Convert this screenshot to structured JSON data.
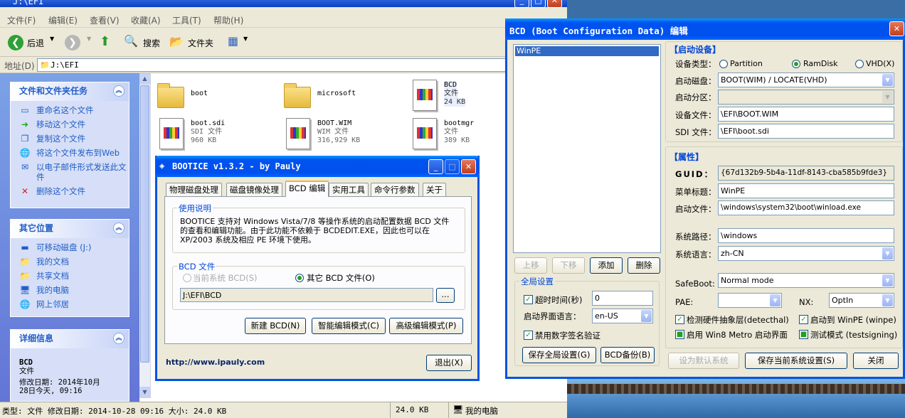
{
  "explorer": {
    "title": "J:\\EFI",
    "menu": [
      "文件(F)",
      "编辑(E)",
      "查看(V)",
      "收藏(A)",
      "工具(T)",
      "帮助(H)"
    ],
    "toolbar": {
      "back": "后退",
      "search": "搜索",
      "folders": "文件夹"
    },
    "address_label": "地址(D)",
    "address_value": "J:\\EFI",
    "tasks": {
      "title": "文件和文件夹任务",
      "items": [
        "重命名这个文件",
        "移动这个文件",
        "复制这个文件",
        "将这个文件发布到Web",
        "以电子邮件形式发送此文件",
        "删除这个文件"
      ]
    },
    "places": {
      "title": "其它位置",
      "items": [
        "可移动磁盘 (J:)",
        "我的文档",
        "共享文档",
        "我的电脑",
        "网上邻居"
      ]
    },
    "details": {
      "title": "详细信息",
      "name": "BCD",
      "type": "文件",
      "modified": "修改日期: 2014年10月28日今天, 09:16"
    },
    "files": [
      {
        "name": "boot",
        "kind": "folder"
      },
      {
        "name": "microsoft",
        "kind": "folder"
      },
      {
        "name": "BCD",
        "type": "文件",
        "size": "24 KB",
        "kind": "file"
      },
      {
        "name": "boot.sdi",
        "type": "SDI 文件",
        "size": "960 KB",
        "kind": "file"
      },
      {
        "name": "BOOT.WIM",
        "type": "WIM 文件",
        "size": "316,929 KB",
        "kind": "file"
      },
      {
        "name": "bootmgr",
        "type": "文件",
        "size": "389 KB",
        "kind": "file"
      }
    ],
    "status": {
      "left": "类型: 文件 修改日期: 2014-10-28 09:16 大小: 24.0 KB",
      "size": "24.0 KB",
      "zone": "我的电脑"
    }
  },
  "bootice": {
    "title": "BOOTICE v1.3.2 - by Pauly",
    "tabs": [
      "物理磁盘处理",
      "磁盘镜像处理",
      "BCD 编辑",
      "实用工具",
      "命令行参数",
      "关于"
    ],
    "usage_title": "使用说明",
    "usage_text": "BOOTICE 支持对 Windows Vista/7/8 等操作系统的启动配置数据 BCD 文件的查看和编辑功能。由于此功能不依赖于 BCDEDIT.EXE，因此也可以在 XP/2003 系统及相应 PE 环境下使用。",
    "bcd_file_title": "BCD 文件",
    "radio_current": "当前系统 BCD(S)",
    "radio_other": "其它 BCD 文件(O)",
    "path": "J:\\EFI\\BCD",
    "browse": "...",
    "btn_new": "新建 BCD(N)",
    "btn_smart": "智能编辑模式(C)",
    "btn_advanced": "高级编辑模式(P)",
    "url": "http://www.ipauly.com",
    "btn_exit": "退出(X)"
  },
  "bcd": {
    "title": "BCD (Boot Configuration Data) 编辑",
    "entries": [
      "WinPE"
    ],
    "btn_up": "上移",
    "btn_down": "下移",
    "btn_add": "添加",
    "btn_delete": "删除",
    "global_title": "全局设置",
    "timeout_label": "超时时间(秒)",
    "timeout_value": "0",
    "ui_lang_label": "启动界面语言：",
    "ui_lang_value": "en-US",
    "disable_sig_label": "禁用数字签名验证",
    "btn_save_global": "保存全局设置(G)",
    "btn_backup": "BCD备份(B)",
    "boot_device_title": "【启动设备】",
    "device_type_label": "设备类型：",
    "device_types": [
      "Partition",
      "RamDisk",
      "VHD(X)"
    ],
    "boot_disk_label": "启动磁盘：",
    "boot_disk_value": "BOOT(WIM) / LOCATE(VHD)",
    "boot_partition_label": "启动分区：",
    "device_file_label": "设备文件：",
    "device_file_value": "\\EFI\\BOOT.WIM",
    "sdi_label": "SDI 文件：",
    "sdi_value": "\\EFI\\boot.sdi",
    "props_title": "【属性】",
    "guid_label": "GUID：",
    "guid_value": "{67d132b9-5b4a-11df-8143-cba585b9fde3}",
    "menu_title_label": "菜单标题：",
    "menu_title_value": "WinPE",
    "boot_file_label": "启动文件：",
    "boot_file_value": "\\windows\\system32\\boot\\winload.exe",
    "sys_path_label": "系统路径：",
    "sys_path_value": "\\windows",
    "sys_lang_label": "系统语言：",
    "sys_lang_value": "zh-CN",
    "safeboot_label": "SafeBoot:",
    "safeboot_value": "Normal mode",
    "pae_label": "PAE:",
    "pae_value": "",
    "nx_label": "NX:",
    "nx_value": "OptIn",
    "chk_detecthal": "检测硬件抽象层(detecthal)",
    "chk_winpe": "启动到 WinPE (winpe)",
    "chk_metro": "启用 Win8 Metro 启动界面",
    "chk_testsigning": "测试模式 (testsigning)",
    "btn_set_default": "设为默认系统",
    "btn_save_current": "保存当前系统设置(S)",
    "btn_close": "关闭"
  }
}
